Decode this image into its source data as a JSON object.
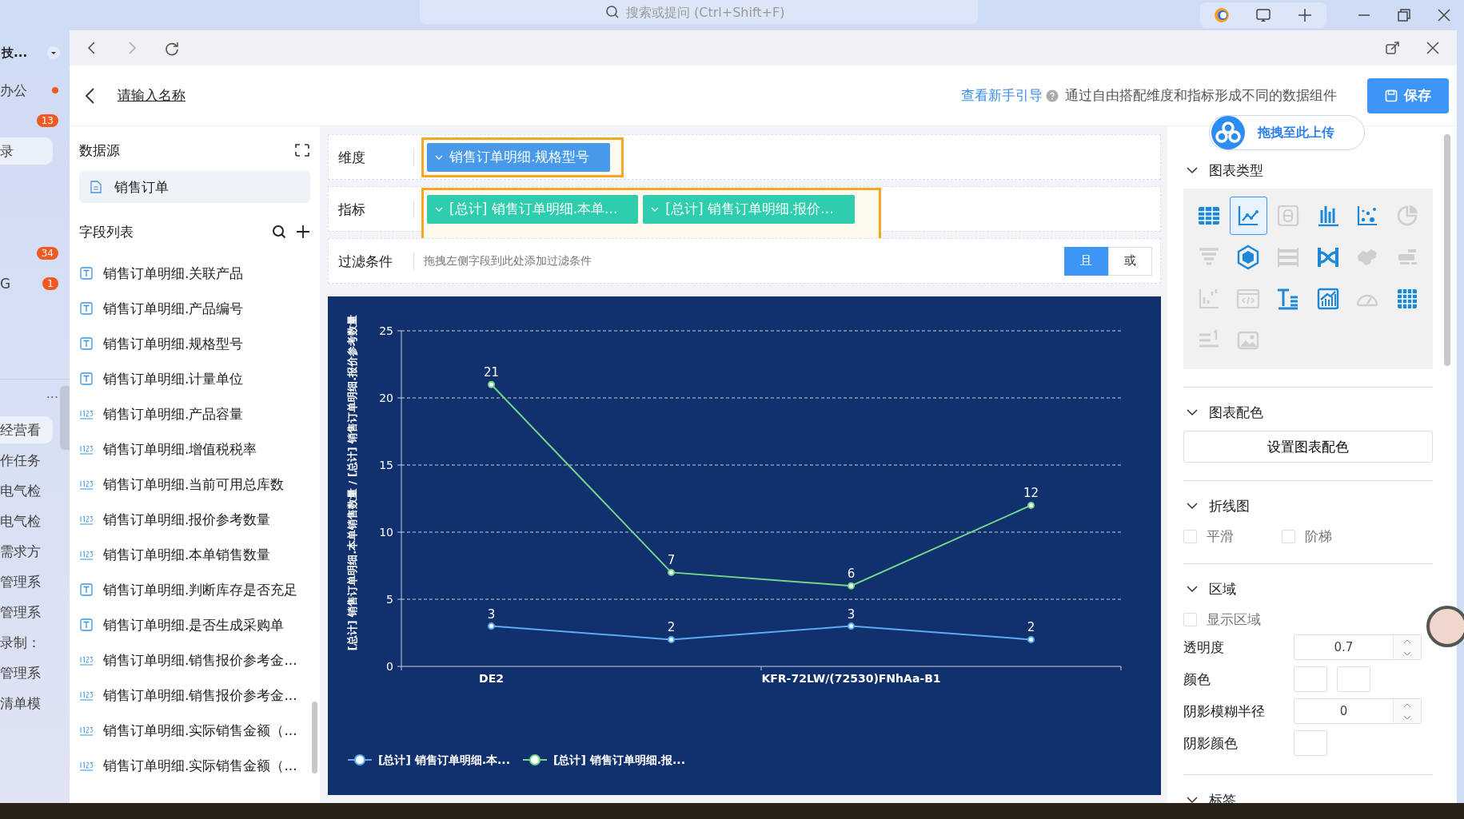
{
  "browser": {
    "search_placeholder": "搜索或提问 (Ctrl+Shift+F)"
  },
  "side_strip": [
    {
      "kind": "account",
      "label": "技..."
    },
    {
      "kind": "item",
      "label": "办公",
      "dot": true,
      "selected": false
    },
    {
      "kind": "badge",
      "count": "13"
    },
    {
      "kind": "item",
      "label": "录",
      "selected": true
    },
    {
      "kind": "spacer"
    },
    {
      "kind": "badge",
      "count": "34"
    },
    {
      "kind": "item",
      "label": "G",
      "badge": "1",
      "selected": false
    },
    {
      "kind": "spacer"
    },
    {
      "kind": "more",
      "label": "···"
    },
    {
      "kind": "item",
      "label": "经营看",
      "selected": true
    },
    {
      "kind": "item",
      "label": "作任务",
      "selected": false
    },
    {
      "kind": "item",
      "label": "电气检",
      "selected": false
    },
    {
      "kind": "item",
      "label": "电气检",
      "selected": false
    },
    {
      "kind": "item",
      "label": "需求方",
      "selected": false
    },
    {
      "kind": "item",
      "label": "管理系",
      "selected": false
    },
    {
      "kind": "item",
      "label": "管理系",
      "selected": false
    },
    {
      "kind": "item",
      "label": "录制：",
      "selected": false
    },
    {
      "kind": "item",
      "label": "管理系",
      "selected": false
    },
    {
      "kind": "item",
      "label": "清单模",
      "selected": false
    }
  ],
  "header": {
    "title": "请输入名称",
    "guide_link": "查看新手引导",
    "help_text": "通过自由搭配维度和指标形成不同的数据组件",
    "save_button": "保存"
  },
  "upload_badge": {
    "label": "拖拽至此上传"
  },
  "left_panel": {
    "datasource_title": "数据源",
    "datasource": "销售订单",
    "fields_title": "字段列表",
    "fields": [
      {
        "kind": "text",
        "label": "销售订单明细.关联产品"
      },
      {
        "kind": "text",
        "label": "销售订单明细.产品编号"
      },
      {
        "kind": "text",
        "label": "销售订单明细.规格型号"
      },
      {
        "kind": "text",
        "label": "销售订单明细.计量单位"
      },
      {
        "kind": "number",
        "label": "销售订单明细.产品容量"
      },
      {
        "kind": "number",
        "label": "销售订单明细.增值税税率"
      },
      {
        "kind": "number",
        "label": "销售订单明细.当前可用总库数"
      },
      {
        "kind": "number",
        "label": "销售订单明细.报价参考数量"
      },
      {
        "kind": "number",
        "label": "销售订单明细.本单销售数量"
      },
      {
        "kind": "text",
        "label": "销售订单明细.判断库存是否充足"
      },
      {
        "kind": "text",
        "label": "销售订单明细.是否生成采购单"
      },
      {
        "kind": "number",
        "label": "销售订单明细.销售报价参考金..."
      },
      {
        "kind": "number",
        "label": "销售订单明细.销售报价参考金..."
      },
      {
        "kind": "number",
        "label": "销售订单明细.实际销售金额（..."
      },
      {
        "kind": "number",
        "label": "销售订单明细.实际销售金额（..."
      }
    ]
  },
  "config": {
    "dimension": {
      "label": "维度",
      "highlighted": true,
      "tags": [
        "销售订单明细.规格型号"
      ]
    },
    "metrics": {
      "label": "指标",
      "highlighted": true,
      "tags": [
        "[总计] 销售订单明细.本单...",
        "[总计] 销售订单明细.报价..."
      ]
    },
    "filter": {
      "label": "过滤条件",
      "hint": "拖拽左侧字段到此处添加过滤条件",
      "logic": [
        {
          "label": "且",
          "selected": true
        },
        {
          "label": "或",
          "selected": false
        }
      ]
    }
  },
  "chart": {
    "chart_data": {
      "type": "line",
      "ylabel": "[总计] 销售订单明细.本单销售数量 / [总计] 销售订单明细.报价参考数量",
      "categories": [
        "DE2",
        null,
        "KFR-72LW/(72530)FNhAa-B1",
        null
      ],
      "series": [
        {
          "name": "[总计] 销售订单明细.本...",
          "color": "#5aaef0",
          "marker": "circle",
          "values": [
            3,
            2,
            3,
            2
          ]
        },
        {
          "name": "[总计] 销售订单明细.报...",
          "color": "#74d68a",
          "marker": "circle",
          "values": [
            21,
            7,
            6,
            12
          ]
        }
      ],
      "ylim": [
        0,
        25
      ],
      "yticks": [
        0,
        5,
        10,
        15,
        20,
        25
      ],
      "grid": true,
      "legend": "bottom-left",
      "data_labels": true
    }
  },
  "right_panel": {
    "chart_type": {
      "title": "图表类型",
      "expanded": true,
      "types": [
        {
          "kind": "table",
          "enabled": true,
          "selected": false
        },
        {
          "kind": "line",
          "enabled": true,
          "selected": true
        },
        {
          "kind": "number",
          "enabled": false,
          "selected": false
        },
        {
          "kind": "bar",
          "enabled": true,
          "selected": false
        },
        {
          "kind": "scatter",
          "enabled": true,
          "selected": false
        },
        {
          "kind": "pie",
          "enabled": false,
          "selected": false
        },
        {
          "kind": "funnel",
          "enabled": false,
          "selected": false
        },
        {
          "kind": "hexagon",
          "enabled": true,
          "selected": false
        },
        {
          "kind": "compare",
          "enabled": false,
          "selected": false
        },
        {
          "kind": "sankey",
          "enabled": true,
          "selected": false
        },
        {
          "kind": "map",
          "enabled": false,
          "selected": false
        },
        {
          "kind": "cloud",
          "enabled": false,
          "selected": false
        },
        {
          "kind": "step",
          "enabled": false,
          "selected": false
        },
        {
          "kind": "code",
          "enabled": false,
          "selected": false
        },
        {
          "kind": "text",
          "enabled": true,
          "selected": false
        },
        {
          "kind": "trend",
          "enabled": true,
          "selected": false
        },
        {
          "kind": "gauge",
          "enabled": false,
          "selected": false
        },
        {
          "kind": "grid",
          "enabled": true,
          "selected": false
        },
        {
          "kind": "ranking",
          "enabled": false,
          "selected": false
        },
        {
          "kind": "image",
          "enabled": false,
          "selected": false
        }
      ]
    },
    "color": {
      "title": "图表配色",
      "expanded": true,
      "button": "设置图表配色"
    },
    "line": {
      "title": "折线图",
      "expanded": true,
      "options": [
        {
          "label": "平滑",
          "checked": false
        },
        {
          "label": "阶梯",
          "checked": false
        }
      ]
    },
    "area": {
      "title": "区域",
      "expanded": true,
      "show": {
        "label": "显示区域",
        "checked": false
      },
      "settings": [
        {
          "kind": "number",
          "label": "透明度",
          "value": "0.7"
        },
        {
          "kind": "color_pair",
          "label": "颜色"
        },
        {
          "kind": "number",
          "label": "阴影模糊半径",
          "value": "0"
        },
        {
          "kind": "color",
          "label": "阴影颜色"
        }
      ]
    },
    "label": {
      "title": "标签",
      "expanded": true
    }
  }
}
